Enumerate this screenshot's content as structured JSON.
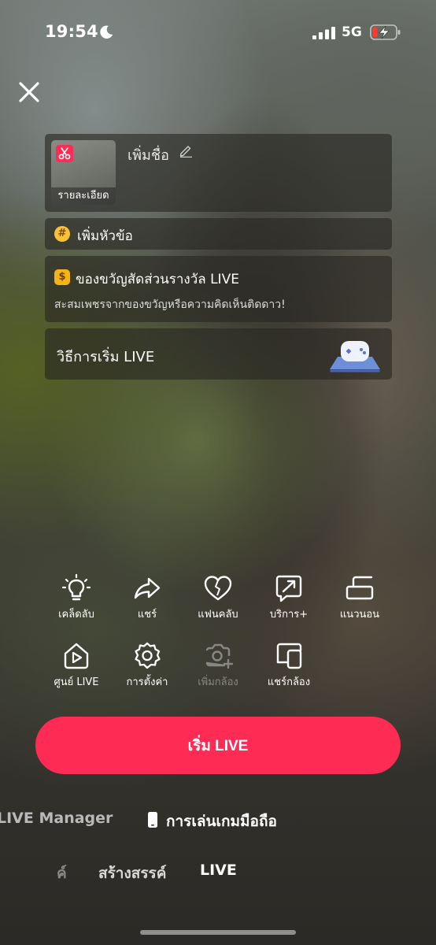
{
  "status_bar": {
    "time": "19:54",
    "network": "5G",
    "icons": [
      "moon-icon",
      "signal-icon",
      "battery-charging-icon"
    ]
  },
  "colors": {
    "accent": "#fe2c55",
    "warning": "#f7c23a",
    "text": "#ffffff"
  },
  "top_bar": {
    "close_icon": "close-icon"
  },
  "title_card": {
    "cover_label": "รายละเอียด",
    "add_title_placeholder": "เพิ่มชื่อ",
    "edit_icon": "pencil-icon"
  },
  "topic_card": {
    "icon": "hashtag-icon",
    "label": "เพิ่มหัวข้อ"
  },
  "gift_card": {
    "icon": "coin-icon",
    "title": "ของขวัญสัดส่วนรางวัล LIVE",
    "subtitle": "สะสมเพชรจากของขวัญหรือความคิดเห็นติดดาว!"
  },
  "howto_card": {
    "label": "วิธีการเริ่ม LIVE",
    "illustration": "game-controller-illustration"
  },
  "tools": {
    "row1": [
      {
        "label": "เคล็ดลับ",
        "icon": "lightbulb-icon"
      },
      {
        "label": "แชร์",
        "icon": "share-arrow-icon"
      },
      {
        "label": "แฟนคลับ",
        "icon": "heart-icon"
      },
      {
        "label": "บริการ+",
        "icon": "service-plus-icon"
      },
      {
        "label": "แนวนอน",
        "icon": "landscape-icon"
      }
    ],
    "row2": [
      {
        "label": "ศูนย์ LIVE",
        "icon": "live-center-icon"
      },
      {
        "label": "การตั้งค่า",
        "icon": "settings-gear-icon"
      },
      {
        "label": "เพิ่มกล้อง",
        "icon": "add-camera-icon",
        "disabled": true
      },
      {
        "label": "แชร์กล้อง",
        "icon": "share-camera-icon"
      }
    ]
  },
  "go_live_button": {
    "label": "เริ่ม LIVE"
  },
  "modes": {
    "manager": "LIVE Manager",
    "mobile_gaming": "การเล่นเกมมือถือ"
  },
  "bottom_tabs": {
    "clipped": "ค์",
    "create": "สร้างสรรค์",
    "live": "LIVE"
  }
}
